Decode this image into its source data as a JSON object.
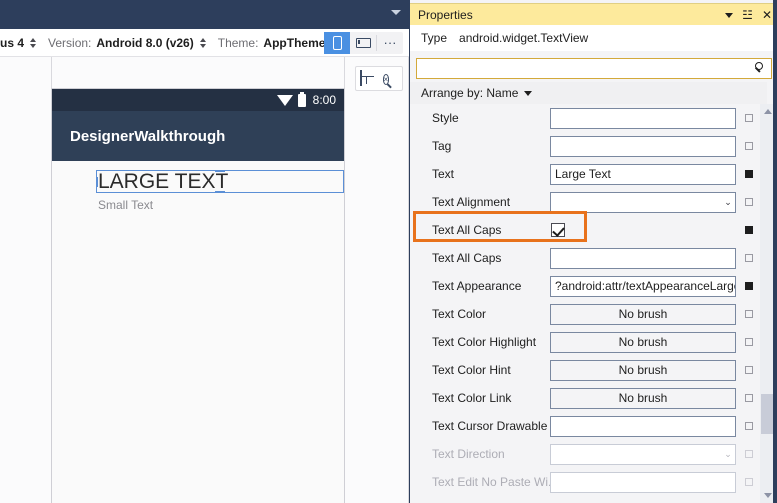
{
  "designer": {
    "titlebar": {
      "chevron_icon": "chevron-down-icon"
    },
    "toolbar": {
      "device_value": "us 4",
      "version_label": "Version:",
      "version_value": "Android 8.0 (v26)",
      "theme_label": "Theme:",
      "theme_value": "AppTheme",
      "viewmode": {
        "portrait_icon": "phone-portrait-icon",
        "landscape_icon": "phone-landscape-icon",
        "more_label": "···",
        "selected": "portrait"
      }
    },
    "canvas_tools": {
      "split_icon": "split-view-icon",
      "zoom_icon": "zoom-reset-icon"
    },
    "phone": {
      "status_time": "8:00",
      "wifi_icon": "wifi-icon",
      "battery_icon": "battery-icon",
      "app_title": "DesignerWalkthrough",
      "large_text": "LARGE TEXT",
      "small_text": "Small Text",
      "selection_color": "#5b8fd6",
      "appbar_color": "#2f4057",
      "statusbar_color": "#243043"
    }
  },
  "properties": {
    "title": "Properties",
    "title_color": "#fdea9c",
    "window_buttons": {
      "dropdown_icon": "chevron-down-icon",
      "pin_label": "☳",
      "close_label": "✕"
    },
    "type_label": "Type",
    "type_value": "android.widget.TextView",
    "search": {
      "value": "",
      "placeholder": "",
      "icon": "search-icon"
    },
    "arrange_by": {
      "label": "Arrange by: Name",
      "caret_icon": "chevron-down-icon"
    },
    "highlight_color": "#e8721c",
    "highlighted_row": "Text All Caps",
    "rows": [
      {
        "name": "Style",
        "kind": "text",
        "value": "",
        "marker": "unset",
        "disabled": false
      },
      {
        "name": "Tag",
        "kind": "text",
        "value": "",
        "marker": "unset",
        "disabled": false
      },
      {
        "name": "Text",
        "kind": "text",
        "value": "Large Text",
        "marker": "set",
        "disabled": false
      },
      {
        "name": "Text Alignment",
        "kind": "combo",
        "value": "",
        "marker": "unset",
        "disabled": false
      },
      {
        "name": "Text All Caps",
        "kind": "checkbox",
        "value": "checked",
        "marker": "set",
        "disabled": false
      },
      {
        "name": "Text All Caps",
        "kind": "text",
        "value": "",
        "marker": "unset",
        "disabled": false
      },
      {
        "name": "Text Appearance",
        "kind": "text",
        "value": "?android:attr/textAppearanceLarge",
        "marker": "set",
        "disabled": false
      },
      {
        "name": "Text Color",
        "kind": "brush",
        "value": "No brush",
        "marker": "unset",
        "disabled": false
      },
      {
        "name": "Text Color Highlight",
        "kind": "brush",
        "value": "No brush",
        "marker": "unset",
        "disabled": false
      },
      {
        "name": "Text Color Hint",
        "kind": "brush",
        "value": "No brush",
        "marker": "unset",
        "disabled": false
      },
      {
        "name": "Text Color Link",
        "kind": "brush",
        "value": "No brush",
        "marker": "unset",
        "disabled": false
      },
      {
        "name": "Text Cursor Drawable",
        "kind": "text",
        "value": "",
        "marker": "unset",
        "disabled": false
      },
      {
        "name": "Text Direction",
        "kind": "combo",
        "value": "",
        "marker": "unset",
        "disabled": true
      },
      {
        "name": "Text Edit No Paste Wi...",
        "kind": "text",
        "value": "",
        "marker": "unset",
        "disabled": true
      }
    ],
    "scrollbar": {
      "up_icon": "scroll-up-icon",
      "down_icon": "scroll-down-icon"
    }
  }
}
